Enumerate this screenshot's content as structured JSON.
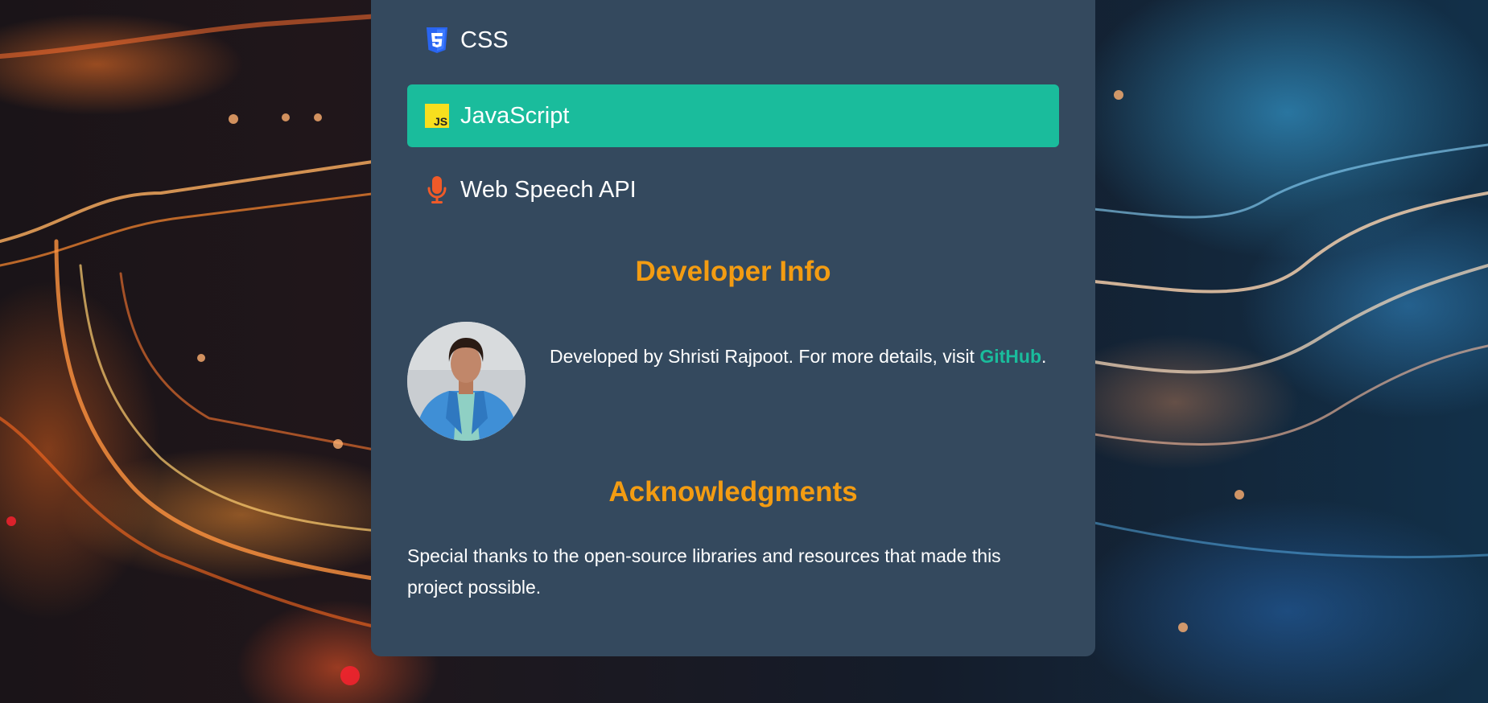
{
  "colors": {
    "panel_bg": "#34495e",
    "accent_teal": "#1abc9c",
    "heading_orange": "#f39c12",
    "css_blue": "#2965f1",
    "js_yellow": "#f7df1e",
    "mic_orange": "#f05a28"
  },
  "tech_list": {
    "items": [
      {
        "label": "CSS",
        "icon": "css3-icon",
        "active": false
      },
      {
        "label": "JavaScript",
        "icon": "javascript-icon",
        "active": true
      },
      {
        "label": "Web Speech API",
        "icon": "microphone-icon",
        "active": false
      }
    ]
  },
  "developer": {
    "heading": "Developer Info",
    "text_before": "Developed by Shristi Rajpoot. For more details, visit ",
    "link_label": "GitHub",
    "text_after": "."
  },
  "acknowledgments": {
    "heading": "Acknowledgments",
    "text": "Special thanks to the open-source libraries and resources that made this project possible."
  }
}
